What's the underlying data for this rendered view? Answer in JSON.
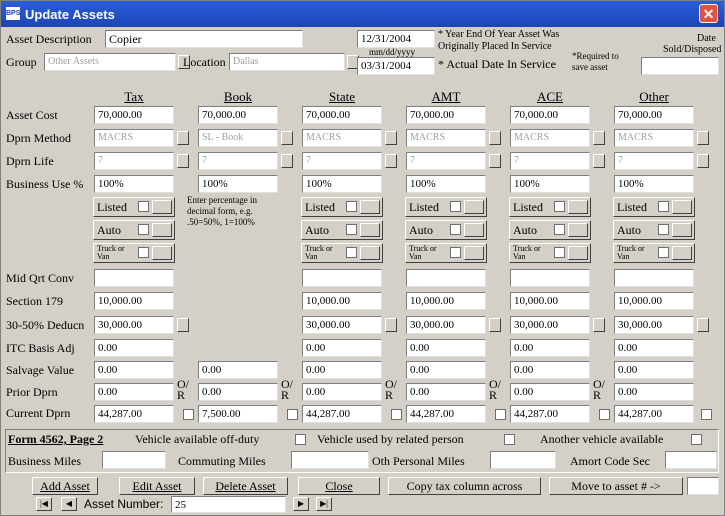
{
  "window": {
    "title": "Update Assets",
    "icon_text": "BPS"
  },
  "header": {
    "asset_description_label": "Asset Description",
    "asset_description_value": "Copier",
    "group_label": "Group",
    "group_value": "Other Assets",
    "location_label": "Location",
    "location_value": "Dallas",
    "date1": "12/31/2004",
    "date_format_hint": "mm/dd/yyyy",
    "date2": "03/31/2004",
    "note1_line1": "* Year End Of Year Asset Was",
    "note1_line2": "Originally Placed In Service",
    "note2": "* Actual Date In Service",
    "note3_line1": "*Required to",
    "note3_line2": "save asset",
    "date_sold_line1": "Date",
    "date_sold_line2": "Sold/Disposed",
    "date_sold_value": ""
  },
  "columns": [
    "Tax",
    "Book",
    "State",
    "AMT",
    "ACE",
    "Other"
  ],
  "rows": {
    "asset_cost": "Asset Cost",
    "dprn_method": "Dprn Method",
    "dprn_life": "Dprn Life",
    "business_use": "Business Use %",
    "mid_qrt": "Mid Qrt Conv",
    "sec179": "Section 179",
    "deduc": "30-50% Deducn",
    "itc": "ITC Basis Adj",
    "salvage": "Salvage Value",
    "prior": "Prior Dprn",
    "current": "Current Dprn"
  },
  "values": {
    "asset_cost": [
      "70,000.00",
      "70,000.00",
      "70,000.00",
      "70,000.00",
      "70,000.00",
      "70,000.00"
    ],
    "dprn_method": [
      "MACRS",
      "SL - Book",
      "MACRS",
      "MACRS",
      "MACRS",
      "MACRS"
    ],
    "dprn_life": [
      "7",
      "7",
      "7",
      "7",
      "7",
      "7"
    ],
    "business_use": [
      "100%",
      "100%",
      "100%",
      "100%",
      "100%",
      "100%"
    ],
    "sec179": [
      "10,000.00",
      "10,000.00",
      "10,000.00",
      "10,000.00",
      "10,000.00"
    ],
    "deduc": [
      "30,000.00",
      "30,000.00",
      "30,000.00",
      "30,000.00",
      "30,000.00"
    ],
    "itc": [
      "0.00",
      "0.00",
      "0.00",
      "0.00",
      "0.00"
    ],
    "salvage": [
      "0.00",
      "0.00",
      "0.00",
      "0.00",
      "0.00",
      "0.00"
    ],
    "prior": [
      "0.00",
      "0.00",
      "0.00",
      "0.00",
      "0.00",
      "0.00"
    ],
    "current": [
      "44,287.00",
      "7,500.00",
      "44,287.00",
      "44,287.00",
      "44,287.00",
      "44,287.00"
    ]
  },
  "checkbox_labels": {
    "listed": "Listed",
    "auto": "Auto",
    "truck_line1": "Truck or",
    "truck_line2": "Van"
  },
  "book_hint": [
    "Enter percentage in",
    "decimal form, e.g.",
    ".50=50%, 1=100%"
  ],
  "or_label": [
    "O/",
    "R"
  ],
  "form4562": {
    "title": "Form 4562, Page 2",
    "vehicle_offduty": "Vehicle available off-duty",
    "vehicle_related": "Vehicle used by related person",
    "another_vehicle": "Another vehicle available",
    "business_miles": "Business Miles",
    "commuting_miles": "Commuting  Miles",
    "oth_personal": "Oth Personal Miles",
    "amort_code": "Amort Code Sec"
  },
  "buttons": {
    "add": "Add Asset",
    "edit": "Edit Asset",
    "delete": "Delete Asset",
    "close": "Close",
    "copy": "Copy tax column across",
    "move": "Move to asset # ->"
  },
  "nav": {
    "asset_number_label": "Asset Number:",
    "asset_number_value": "25"
  }
}
